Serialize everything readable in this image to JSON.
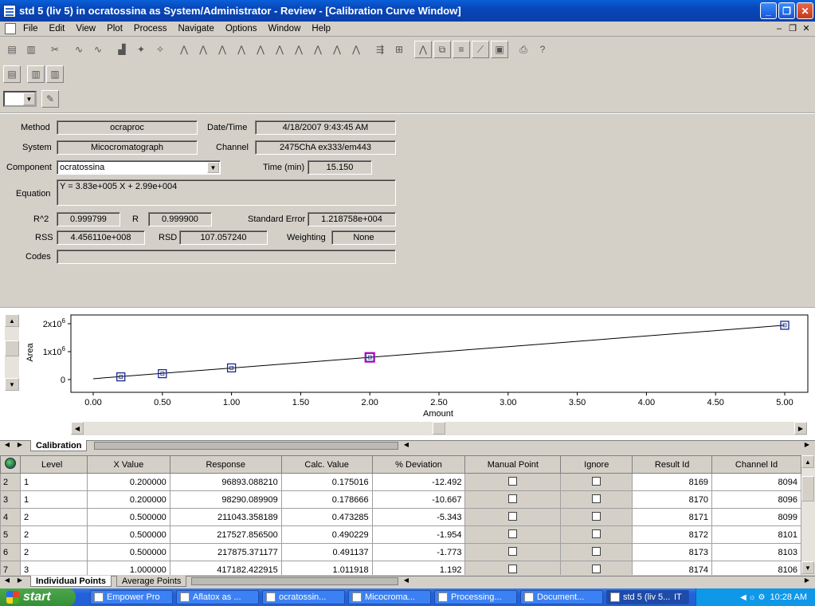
{
  "window": {
    "title": "std 5 (liv 5) in ocratossina as System/Administrator - Review - [Calibration Curve Window]",
    "controls": {
      "minimize": "_",
      "restore": "❐",
      "close": "✕"
    }
  },
  "menu": [
    "File",
    "Edit",
    "View",
    "Plot",
    "Process",
    "Navigate",
    "Options",
    "Window",
    "Help"
  ],
  "form": {
    "method_label": "Method",
    "method": "ocraproc",
    "datetime_label": "Date/Time",
    "datetime": "4/18/2007 9:43:45 AM",
    "system_label": "System",
    "system": "Micocromatograph",
    "channel_label": "Channel",
    "channel": "2475ChA ex333/em443",
    "component_label": "Component",
    "component": "ocratossina",
    "time_label": "Time (min)",
    "time": "15.150",
    "equation_label": "Equation",
    "equation": "Y = 3.83e+005 X + 2.99e+004",
    "r2_label": "R^2",
    "r2": "0.999799",
    "r_label": "R",
    "r": "0.999900",
    "stderr_label": "Standard Error",
    "stderr": "1.218758e+004",
    "rss_label": "RSS",
    "rss": "4.456110e+008",
    "rsd_label": "RSD",
    "rsd": "107.057240",
    "weighting_label": "Weighting",
    "weighting": "None",
    "codes_label": "Codes",
    "codes": ""
  },
  "chart_data": {
    "type": "scatter",
    "xlabel": "Amount",
    "ylabel": "Area",
    "xlim": [
      0,
      5
    ],
    "x_ticks": [
      "0.00",
      "0.50",
      "1.00",
      "1.50",
      "2.00",
      "2.50",
      "3.00",
      "3.50",
      "4.00",
      "4.50",
      "5.00"
    ],
    "y_ticks": [
      "0",
      "1x10",
      "2x10"
    ],
    "y_tick_exponent": "6",
    "points": [
      {
        "x": 0.2,
        "y": 96893
      },
      {
        "x": 0.5,
        "y": 211043
      },
      {
        "x": 1.0,
        "y": 417182
      },
      {
        "x": 2.0,
        "y": 795000
      },
      {
        "x": 5.0,
        "y": 1945000
      }
    ],
    "fit_line": {
      "slope": 383000,
      "intercept": 29900,
      "x_range": [
        0,
        5
      ]
    },
    "point_color": "#1a2a8a",
    "highlight_color": "#d000d0"
  },
  "chart_tabs": {
    "calibration": "Calibration"
  },
  "table": {
    "columns": [
      "Level",
      "X Value",
      "Response",
      "Calc. Value",
      "% Deviation",
      "Manual Point",
      "Ignore",
      "Result Id",
      "Channel Id"
    ],
    "rows": [
      [
        "2",
        "1",
        "0.200000",
        "96893.088210",
        "0.175016",
        "-12.492",
        "8169",
        "8094"
      ],
      [
        "3",
        "1",
        "0.200000",
        "98290.089909",
        "0.178666",
        "-10.667",
        "8170",
        "8096"
      ],
      [
        "4",
        "2",
        "0.500000",
        "211043.358189",
        "0.473285",
        "-5.343",
        "8171",
        "8099"
      ],
      [
        "5",
        "2",
        "0.500000",
        "217527.856500",
        "0.490229",
        "-1.954",
        "8172",
        "8101"
      ],
      [
        "6",
        "2",
        "0.500000",
        "217875.371177",
        "0.491137",
        "-1.773",
        "8173",
        "8103"
      ],
      [
        "7",
        "3",
        "1.000000",
        "417182.422915",
        "1.011918",
        "1.192",
        "8174",
        "8106"
      ]
    ]
  },
  "grid_tabs": {
    "individual": "Individual Points",
    "average": "Average Points"
  },
  "taskbar": {
    "start": "start",
    "tasks": [
      "Empower Pro",
      "Aflatox as ...",
      "ocratossin...",
      "Micocroma...",
      "Processing...",
      "Document...",
      "std 5 (liv 5..."
    ],
    "lang": "IT",
    "clock": "10:28 AM"
  }
}
